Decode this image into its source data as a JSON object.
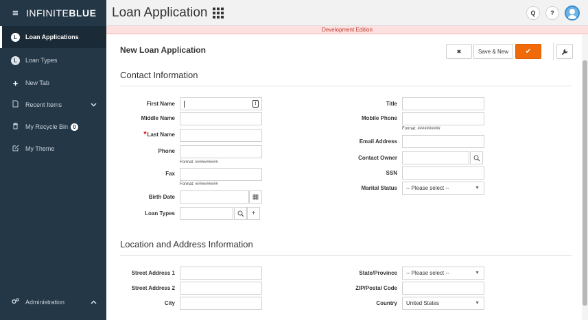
{
  "sidebar": {
    "logo_light": "INFINITE",
    "logo_bold": "BLUE",
    "items": [
      {
        "label": "Loan Applications",
        "initial": "L"
      },
      {
        "label": "Loan Types",
        "initial": "L"
      },
      {
        "label": "New Tab",
        "icon": "plus-icon"
      },
      {
        "label": "Recent Items",
        "icon": "document-icon"
      },
      {
        "label": "My Recycle Bin",
        "icon": "trash-icon",
        "badge": "0"
      },
      {
        "label": "My Theme",
        "icon": "edit-icon"
      }
    ],
    "admin": {
      "label": "Administration",
      "icon": "gears-icon"
    }
  },
  "header": {
    "title": "Loan Application",
    "search_label": "Q",
    "help_label": "?"
  },
  "banner": "Development Edition",
  "form": {
    "title": "New Loan Application",
    "cancel_label": "✖",
    "save_new_label": "Save & New",
    "save_label": "✔",
    "wrench_label": "🔧"
  },
  "contact": {
    "title": "Contact Information",
    "first_name": "First Name",
    "middle_name": "Middle Name",
    "last_name": "Last Name",
    "required_mark": "*",
    "phone": "Phone",
    "phone_hint": "Format: ##########",
    "fax": "Fax",
    "fax_hint": "Format: ##########",
    "birth_date": "Birth Date",
    "loan_types": "Loan Types",
    "title_label": "Title",
    "mobile_phone": "Mobile Phone",
    "mobile_hint": "Format: ##########",
    "email": "Email Address",
    "contact_owner": "Contact Owner",
    "ssn": "SSN",
    "marital_status": "Marital Status",
    "marital_value": "-- Please select --",
    "plus_label": "+",
    "search_glyph": "⚲",
    "pw_glyph": "!",
    "cal_glyph": "▦"
  },
  "address": {
    "title": "Location and Address Information",
    "street1": "Street Address 1",
    "street2": "Street Address 2",
    "city": "City",
    "state": "State/Province",
    "state_value": "-- Please select --",
    "zip": "ZIP/Postal Code",
    "country": "Country",
    "country_value": "United States",
    "arrow": "▼"
  }
}
